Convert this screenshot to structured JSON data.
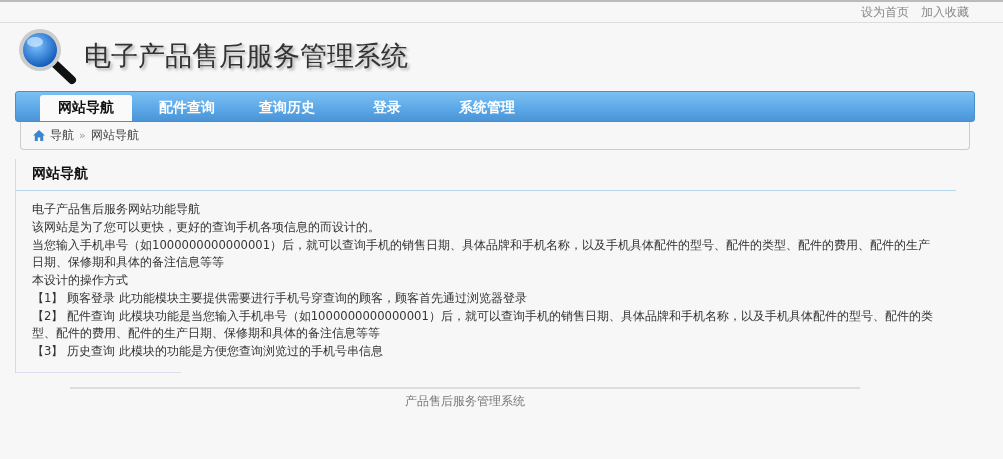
{
  "top_links": [
    "设为首页",
    "加入收藏"
  ],
  "site_title": "电子产品售后服务管理系统",
  "nav": [
    {
      "label": "网站导航",
      "selected": true
    },
    {
      "label": "配件查询",
      "selected": false
    },
    {
      "label": "查询历史",
      "selected": false
    },
    {
      "label": "登录",
      "selected": false
    },
    {
      "label": "系统管理",
      "selected": false
    }
  ],
  "breadcrumb": [
    "导航",
    "»",
    "网站导航"
  ],
  "panel": {
    "title": "网站导航",
    "paragraphs": [
      "电子产品售后服务网站功能导航",
      "该网站是为了您可以更快，更好的查询手机各项信息的而设计的。",
      "当您输入手机串号（如1000000000000001）后，就可以查询手机的销售日期、具体品牌和手机名称，以及手机具体配件的型号、配件的类型、配件的费用、配件的生产日期、保修期和具体的备注信息等等",
      "本设计的操作方式",
      "【1】 顾客登录 此功能模块主要提供需要进行手机号穿查询的顾客，顾客首先通过浏览器登录",
      "【2】 配件查询 此模块功能是当您输入手机串号（如1000000000000001）后，就可以查询手机的销售日期、具体品牌和手机名称，以及手机具体配件的型号、配件的类型、配件的费用、配件的生产日期、保修期和具体的备注信息等等",
      "【3】 历史查询 此模块的功能是方便您查询浏览过的手机号串信息"
    ]
  },
  "footer": "产品售后服务管理系统"
}
